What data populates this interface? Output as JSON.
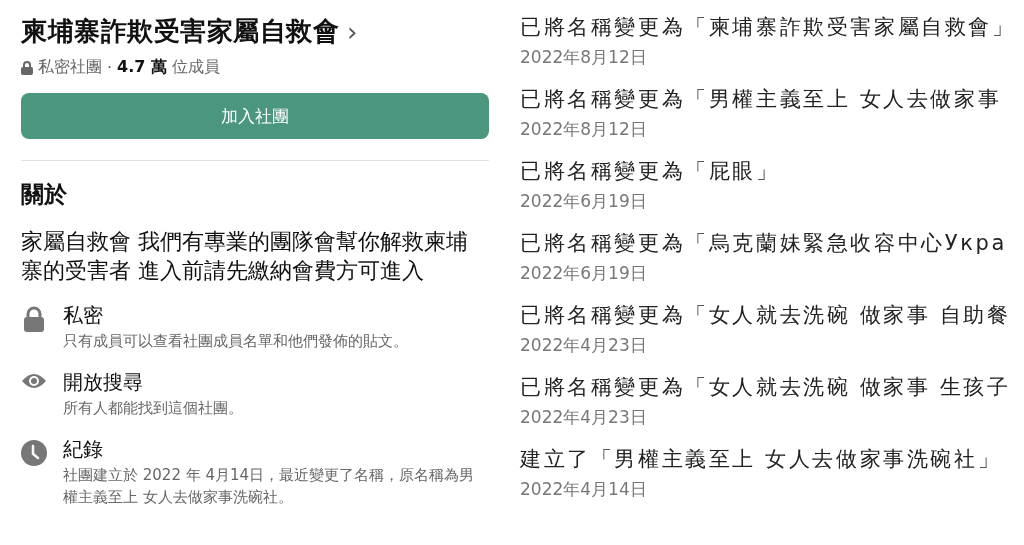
{
  "group": {
    "name": "柬埔寨詐欺受害家屬自救會",
    "chevron": "›",
    "privacy": "私密社團",
    "separator": "·",
    "member_count": "4.7 萬",
    "member_label": "位成員",
    "join_button": "加入社團"
  },
  "about": {
    "heading": "關於",
    "description": "家屬自救會 我們有專業的團隊會幫你解救柬埔寨的受害者 進入前請先繳納會費方可進入",
    "items": [
      {
        "kind": "lock",
        "title": "私密",
        "text": "只有成員可以查看社團成員名單和他們發佈的貼文。"
      },
      {
        "kind": "eye",
        "title": "開放搜尋",
        "text": "所有人都能找到這個社團。"
      },
      {
        "kind": "clock",
        "title": "紀錄",
        "text": "社團建立於 2022 年 4月14日，最近變更了名稱，原名稱為男權主義至上 女人去做家事洗碗社。"
      }
    ]
  },
  "history": [
    {
      "text": "已將名稱變更為「柬埔寨詐欺受害家屬自救會」",
      "date": "2022年8月12日"
    },
    {
      "text": "已將名稱變更為「男權主義至上 女人去做家事",
      "date": "2022年8月12日"
    },
    {
      "text": "已將名稱變更為「屁眼」",
      "date": "2022年6月19日"
    },
    {
      "text": "已將名稱變更為「烏克蘭妹緊急收容中心Укра",
      "date": "2022年6月19日"
    },
    {
      "text": "已將名稱變更為「女人就去洗碗 做家事 自助餐",
      "date": "2022年4月23日"
    },
    {
      "text": "已將名稱變更為「女人就去洗碗 做家事 生孩子",
      "date": "2022年4月23日"
    },
    {
      "text": "建立了「男權主義至上 女人去做家事洗碗社」",
      "date": "2022年4月14日"
    }
  ]
}
